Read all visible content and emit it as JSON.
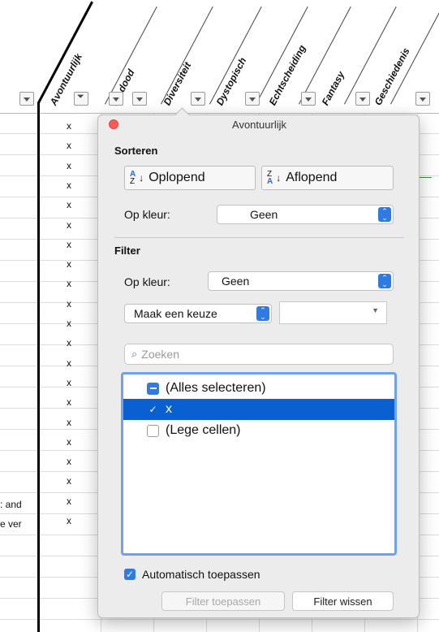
{
  "spreadsheet": {
    "column_headers": [
      "Avontuurlijk",
      "De dood",
      "Diversiteit",
      "Dystopisch",
      "Echtscheiding",
      "Fantasy",
      "Geschiedenis"
    ],
    "active_filter_column": "Avontuurlijk",
    "column_values": [
      "x",
      "x",
      "x",
      "x",
      "x",
      "x",
      "x",
      "x",
      "x",
      "x",
      "x",
      "x",
      "x",
      "x",
      "x",
      "x",
      "x",
      "x",
      "x",
      "x",
      "x"
    ],
    "left_cell_texts": [
      ": and",
      "e ver"
    ]
  },
  "filter_panel": {
    "title": "Avontuurlijk",
    "sort": {
      "section_title": "Sorteren",
      "ascending_label": "Oplopend",
      "descending_label": "Aflopend",
      "by_color_label": "Op kleur:",
      "by_color_value": "Geen"
    },
    "filter": {
      "section_title": "Filter",
      "by_color_label": "Op kleur:",
      "by_color_value": "Geen",
      "condition_value": "Maak een keuze",
      "condition_input_value": "",
      "search_placeholder": "Zoeken",
      "items": [
        {
          "label": "(Alles selecteren)",
          "state": "mixed",
          "selected": false
        },
        {
          "label": "x",
          "state": "checked",
          "selected": true
        },
        {
          "label": "(Lege cellen)",
          "state": "unchecked",
          "selected": false
        }
      ],
      "auto_apply_label": "Automatisch toepassen",
      "auto_apply_checked": true,
      "apply_button_label": "Filter toepassen",
      "clear_button_label": "Filter wissen"
    }
  },
  "colors": {
    "accent": "#2f7be6",
    "selection": "#0a5fd1",
    "close_button": "#fc5b57"
  }
}
